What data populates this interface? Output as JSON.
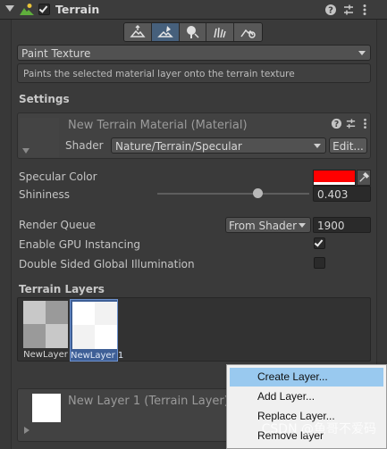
{
  "header": {
    "title": "Terrain",
    "enabled": true,
    "icons": [
      "help-icon",
      "preset-icon",
      "more-menu-icon"
    ]
  },
  "tools": [
    {
      "name": "raise-lower-terrain-icon",
      "active": false
    },
    {
      "name": "paint-terrain-icon",
      "active": true
    },
    {
      "name": "paint-trees-icon",
      "active": false
    },
    {
      "name": "paint-details-icon",
      "active": false
    },
    {
      "name": "terrain-settings-icon",
      "active": false
    }
  ],
  "paint_mode": {
    "selected": "Paint Texture",
    "description": "Paints the selected material layer onto the terrain texture"
  },
  "settings": {
    "heading": "Settings",
    "material": {
      "name": "New Terrain Material (Material)",
      "shader_label": "Shader",
      "shader_value": "Nature/Terrain/Specular",
      "edit_label": "Edit..."
    },
    "specular_color": {
      "label": "Specular Color",
      "color": "#ff0000"
    },
    "shininess": {
      "label": "Shininess",
      "value": "0.403",
      "slider_fraction": 0.403
    },
    "render_queue": {
      "label": "Render Queue",
      "mode": "From Shader",
      "value": "1900"
    },
    "gpu_instancing": {
      "label": "Enable GPU Instancing",
      "checked": true
    },
    "double_sided_gi": {
      "label": "Double Sided Global Illumination",
      "checked": false
    }
  },
  "terrain_layers": {
    "heading": "Terrain Layers",
    "items": [
      {
        "name": "NewLayer",
        "selected": false
      },
      {
        "name": "NewLayer 1",
        "selected": true
      }
    ]
  },
  "selected_layer": {
    "name": "New Layer 1 (Terrain Layer)"
  },
  "context_menu": {
    "items": [
      {
        "label": "Create Layer...",
        "highlighted": true
      },
      {
        "label": "Add Layer...",
        "highlighted": false
      },
      {
        "label": "Replace Layer...",
        "highlighted": false
      },
      {
        "label": "Remove layer",
        "highlighted": false
      }
    ]
  },
  "watermark": "CSDN @鱼哥不爱码"
}
